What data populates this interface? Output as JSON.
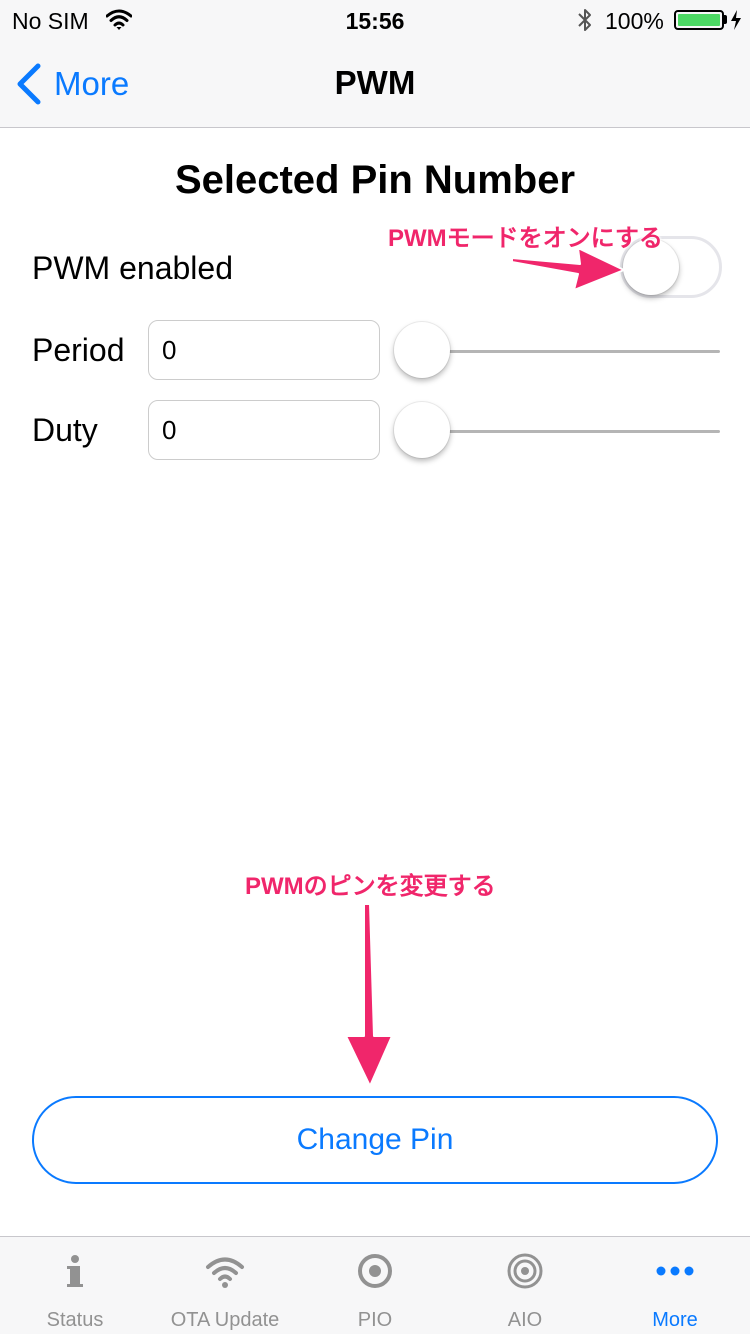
{
  "status_bar": {
    "carrier": "No SIM",
    "time": "15:56",
    "battery_percent": "100%",
    "battery_level": 1.0,
    "icons": [
      "wifi-icon",
      "bluetooth-icon",
      "battery-icon",
      "charging-icon"
    ]
  },
  "nav": {
    "back_label": "More",
    "title": "PWM"
  },
  "content": {
    "section_title": "Selected Pin Number",
    "pwm_enabled_label": "PWM enabled",
    "pwm_enabled": false,
    "period_label": "Period",
    "period_value": "0",
    "period_slider": 0,
    "duty_label": "Duty",
    "duty_value": "0",
    "duty_slider": 0,
    "change_pin_label": "Change Pin"
  },
  "annotations": {
    "toggle_note": "PWMモードをオンにする",
    "change_pin_note": "PWMのピンを変更する"
  },
  "tab_bar": {
    "tabs": [
      {
        "label": "Status",
        "icon": "info-icon",
        "active": false
      },
      {
        "label": "OTA Update",
        "icon": "wifi-icon",
        "active": false
      },
      {
        "label": "PIO",
        "icon": "radio-target-icon",
        "active": false
      },
      {
        "label": "AIO",
        "icon": "concentric-target-icon",
        "active": false
      },
      {
        "label": "More",
        "icon": "more-dots-icon",
        "active": true
      }
    ]
  },
  "colors": {
    "accent": "#0a7aff",
    "annotation": "#f0266b",
    "battery_fill": "#4cd964",
    "tab_inactive": "#929292"
  }
}
